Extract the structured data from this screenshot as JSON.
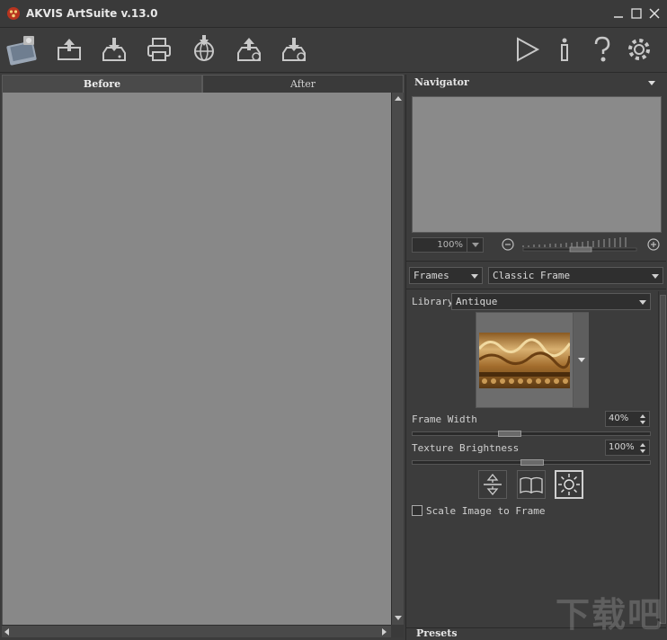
{
  "window": {
    "title": "AKVIS ArtSuite v.13.0"
  },
  "toolbar": {
    "buttons": [
      "home-icon",
      "open-icon",
      "save-icon",
      "print-icon",
      "share-icon",
      "batch-icon",
      "settings-batch-icon",
      "run-icon",
      "info-icon",
      "help-icon",
      "gear-icon"
    ]
  },
  "tabs": {
    "before": "Before",
    "after": "After"
  },
  "navigator": {
    "title": "Navigator",
    "zoom": "100%"
  },
  "effect": {
    "category": "Frames",
    "frame_type": "Classic Frame"
  },
  "settings": {
    "library_label": "Library",
    "library_value": "Antique",
    "frame_width_label": "Frame Width",
    "frame_width_value": "40%",
    "texture_brightness_label": "Texture Brightness",
    "texture_brightness_value": "100%",
    "scale_label": "Scale Image to Frame",
    "scale_checked": false
  },
  "presets": {
    "title": "Presets"
  },
  "watermark": "下载吧"
}
